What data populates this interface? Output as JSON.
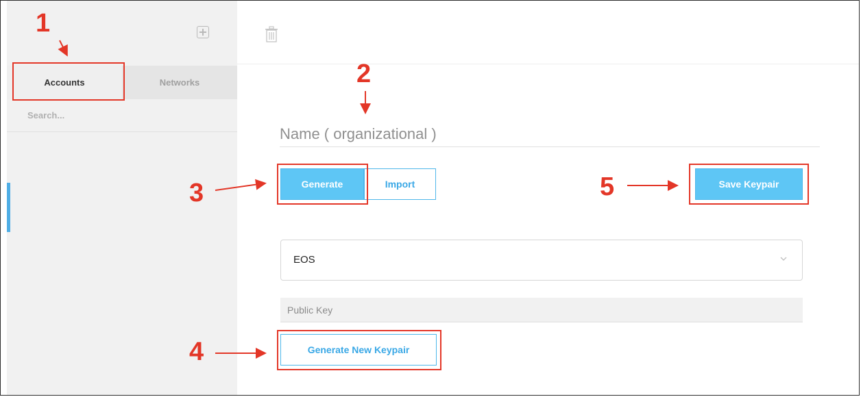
{
  "sidebar": {
    "tabs": [
      {
        "label": "Accounts",
        "selected": true
      },
      {
        "label": "Networks",
        "selected": false
      }
    ],
    "search_placeholder": "Search...",
    "add_icon": "plus-square-icon"
  },
  "main": {
    "trash_icon": "trash-icon",
    "name_placeholder": "Name ( organizational )",
    "generate_label": "Generate",
    "import_label": "Import",
    "save_label": "Save Keypair",
    "network_select_value": "EOS",
    "public_key_placeholder": "Public Key",
    "new_keypair_label": "Generate New Keypair"
  },
  "annotations": {
    "labels": [
      "1",
      "2",
      "3",
      "4",
      "5"
    ],
    "color": "#e33627"
  },
  "colors": {
    "accent": "#5ec6f5",
    "accent_text": "#3aa8e6",
    "sidebar_bg": "#f1f1f1"
  }
}
